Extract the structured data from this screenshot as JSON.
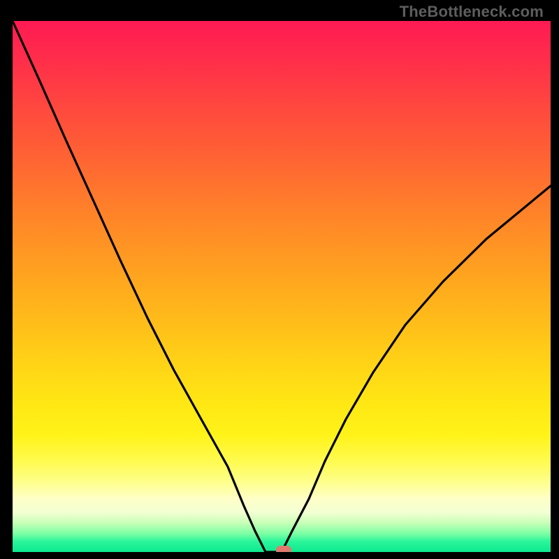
{
  "watermark": "TheBottleneck.com",
  "chart_data": {
    "type": "line",
    "title": "",
    "xlabel": "",
    "ylabel": "",
    "xlim": [
      0,
      100
    ],
    "ylim": [
      0,
      100
    ],
    "grid": false,
    "legend": false,
    "annotations": [],
    "background_gradient": {
      "orientation": "vertical",
      "stops": [
        {
          "pos": 0.0,
          "color": "#ff1a53"
        },
        {
          "pos": 0.25,
          "color": "#ff6a32"
        },
        {
          "pos": 0.5,
          "color": "#ffb01d"
        },
        {
          "pos": 0.72,
          "color": "#ffe714"
        },
        {
          "pos": 0.88,
          "color": "#fdffb0"
        },
        {
          "pos": 0.96,
          "color": "#8cffac"
        },
        {
          "pos": 1.0,
          "color": "#0ce98f"
        }
      ]
    },
    "series": [
      {
        "name": "left-branch",
        "x": [
          0,
          5,
          10,
          15,
          20,
          25,
          30,
          35,
          40,
          43,
          45,
          47
        ],
        "y": [
          100,
          89,
          77,
          66,
          55,
          44,
          34,
          25,
          16,
          9,
          4,
          0
        ]
      },
      {
        "name": "flat-min",
        "x": [
          47,
          50
        ],
        "y": [
          0,
          0
        ]
      },
      {
        "name": "right-branch",
        "x": [
          50,
          52,
          55,
          58,
          62,
          67,
          73,
          80,
          88,
          100
        ],
        "y": [
          0,
          4,
          10,
          17,
          25,
          34,
          43,
          51,
          59,
          69
        ]
      }
    ],
    "marker": {
      "name": "current-point",
      "x": 50,
      "y": 0,
      "shape": "rounded-rect",
      "color": "#e07a6e"
    }
  }
}
